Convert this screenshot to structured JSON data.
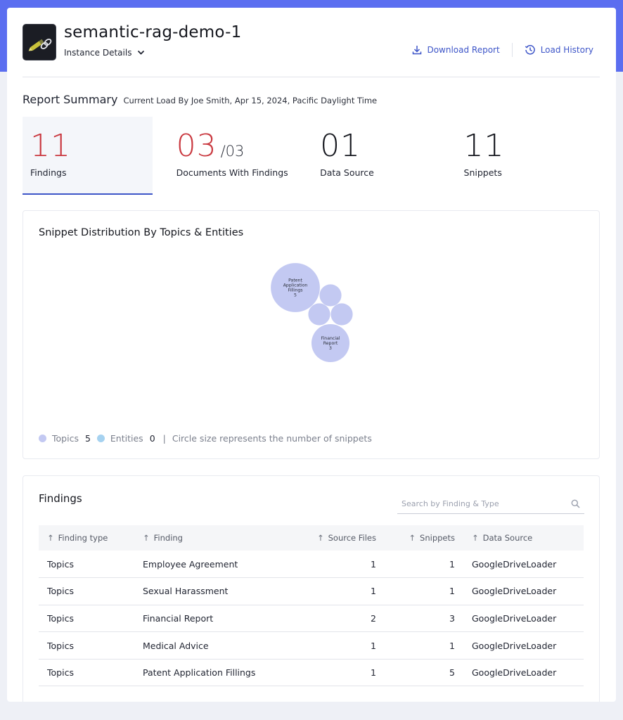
{
  "header": {
    "title": "semantic-rag-demo-1",
    "instance_details_label": "Instance Details",
    "download_report_label": "Download Report",
    "load_history_label": "Load History"
  },
  "summary": {
    "title": "Report Summary",
    "subtitle": "Current Load By Joe Smith, Apr 15, 2024, Pacific Daylight Time",
    "stats": [
      {
        "value": "11",
        "label": "Findings"
      },
      {
        "value": "03",
        "denominator": "/03",
        "label": "Documents With Findings"
      },
      {
        "value": "01",
        "label": "Data Source"
      },
      {
        "value": "11",
        "label": "Snippets"
      }
    ]
  },
  "chart": {
    "title": "Snippet Distribution By Topics & Entities",
    "legend": {
      "topics_label": "Topics",
      "topics_count": "5",
      "entities_label": "Entities",
      "entities_count": "0",
      "separator": "|",
      "note": "Circle size represents the number of snippets"
    },
    "colors": {
      "topics": "#c3c9f2",
      "entities": "#a6d2f0"
    }
  },
  "chart_data": {
    "type": "bubble",
    "title": "Snippet Distribution By Topics & Entities",
    "series": [
      {
        "name": "Topics",
        "points": [
          {
            "label": "Patent Application Fillings",
            "value": 5
          },
          {
            "label": "Financial Report",
            "value": 3
          },
          {
            "label": "",
            "value": 1
          },
          {
            "label": "",
            "value": 1
          },
          {
            "label": "",
            "value": 1
          }
        ]
      },
      {
        "name": "Entities",
        "points": []
      }
    ]
  },
  "findings": {
    "title": "Findings",
    "search_placeholder": "Search by Finding & Type",
    "columns": [
      "Finding type",
      "Finding",
      "Source Files",
      "Snippets",
      "Data Source"
    ],
    "rows": [
      [
        "Topics",
        "Employee Agreement",
        "1",
        "1",
        "GoogleDriveLoader"
      ],
      [
        "Topics",
        "Sexual Harassment",
        "1",
        "1",
        "GoogleDriveLoader"
      ],
      [
        "Topics",
        "Financial Report",
        "2",
        "3",
        "GoogleDriveLoader"
      ],
      [
        "Topics",
        "Medical Advice",
        "1",
        "1",
        "GoogleDriveLoader"
      ],
      [
        "Topics",
        "Patent Application Fillings",
        "1",
        "5",
        "GoogleDriveLoader"
      ]
    ]
  }
}
